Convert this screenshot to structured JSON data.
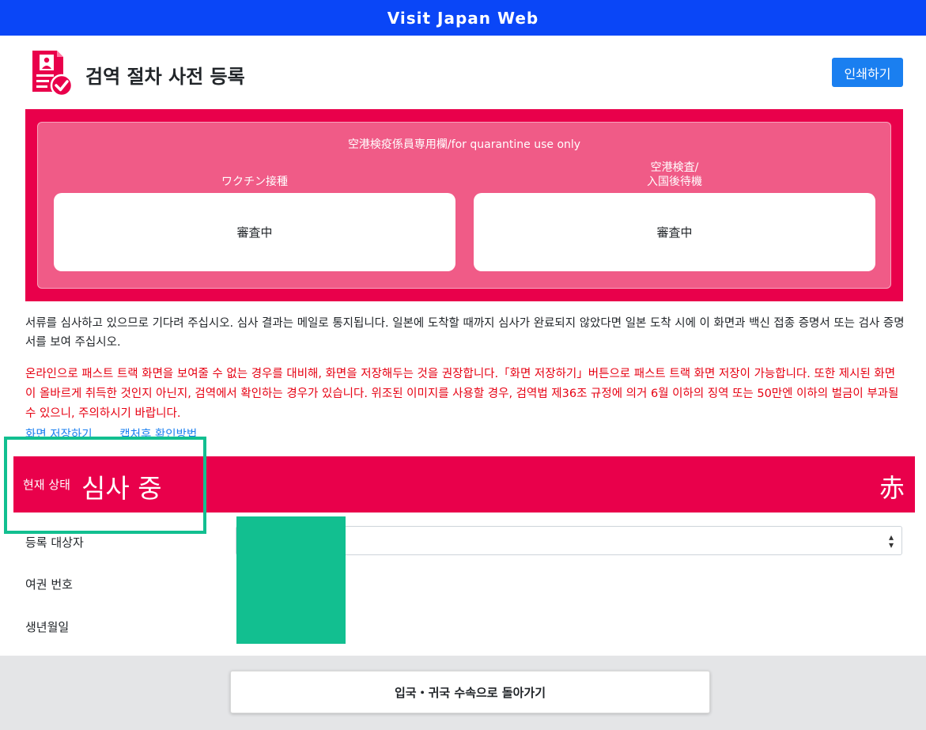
{
  "header": {
    "app_title": "Visit Japan Web"
  },
  "page": {
    "title": "검역 절차 사전 등록",
    "print_label": "인쇄하기",
    "icon": "document-check-icon"
  },
  "quarantine": {
    "title": "空港検疫係員専用欄/for quarantine use only",
    "vaccine_label": "ワクチン接種",
    "vaccine_status": "審査中",
    "inspection_label_line1": "空港検査/",
    "inspection_label_line2": "入国後待機",
    "inspection_status": "審査中"
  },
  "notice": "서류를 심사하고 있으므로 기다려 주십시오. 심사 결과는 메일로 통지됩니다. 일본에 도착할 때까지 심사가 완료되지 않았다면 일본 도착 시에 이 화면과 백신 접종 증명서 또는 검사 증명서를 보여 주십시오.",
  "warning": "온라인으로 패스트 트랙 화면을 보여줄 수 없는 경우를 대비해, 화면을 저장해두는 것을 권장합니다.「화면 저장하기」버튼으로 패스트 트랙 화면 저장이 가능합니다. 또한 제시된 화면이 올바르게 취득한 것인지 아닌지, 검역에서 확인하는 경우가 있습니다. 위조된 이미지를 사용할 경우, 검역법 제36조 규정에 의거 6월 이하의 징역 또는 50만엔 이하의 벌금이 부과될 수 있으니, 주의하시기 바랍니다.",
  "links": {
    "save_screen": "화면 저장하기",
    "capture_check": "캡처후 확인방법"
  },
  "status": {
    "label": "현재 상태",
    "value": "심사 중",
    "kanji": "赤",
    "color": "#e9004b"
  },
  "fields": {
    "registrant": "등록 대상자",
    "passport": "여권 번호",
    "birthdate": "생년월일"
  },
  "footer": {
    "back_label": "입국・귀국 수속으로 돌아가기"
  },
  "colors": {
    "brand_blue": "#0a46f7",
    "accent_red": "#e9004b",
    "warning_red": "#e60012",
    "highlight_green": "#12bf90"
  }
}
